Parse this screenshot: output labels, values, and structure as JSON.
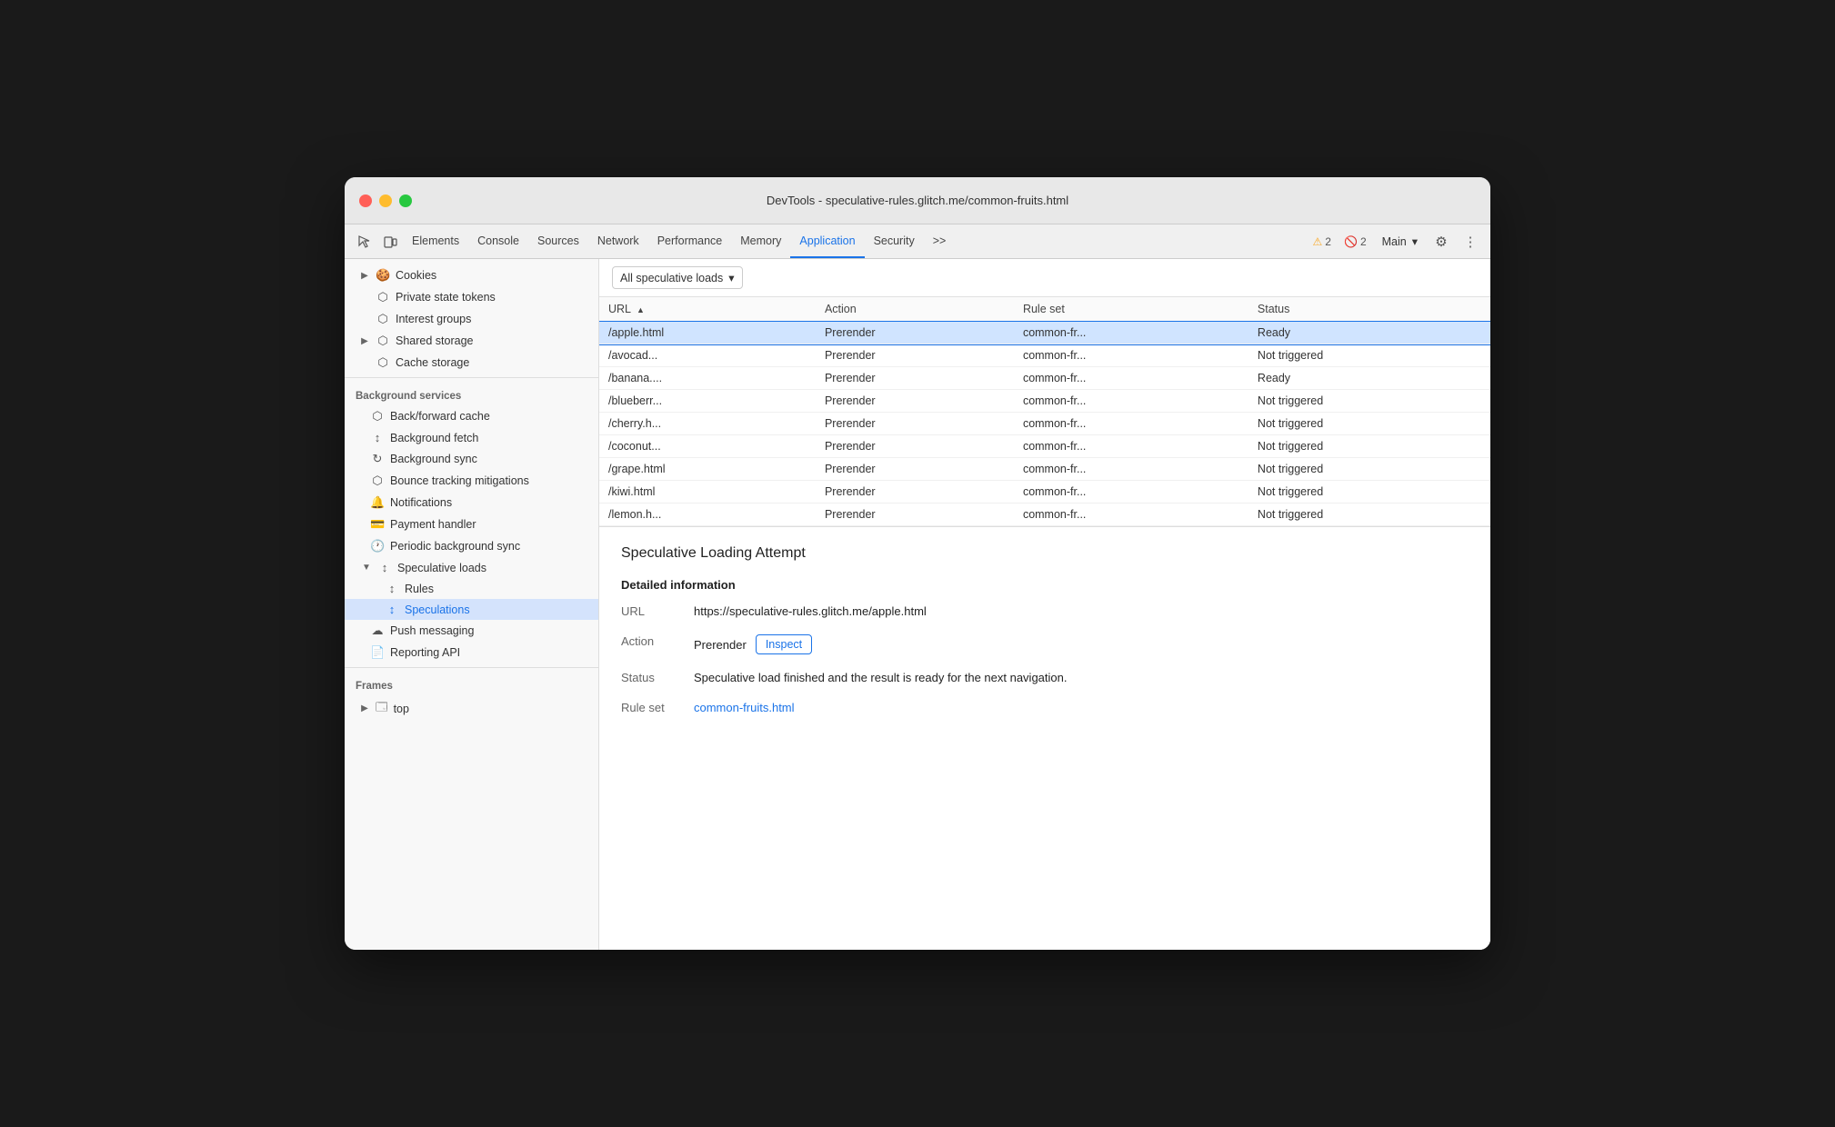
{
  "window": {
    "title": "DevTools - speculative-rules.glitch.me/common-fruits.html"
  },
  "tabs": {
    "items": [
      {
        "label": "Elements",
        "active": false
      },
      {
        "label": "Console",
        "active": false
      },
      {
        "label": "Sources",
        "active": false
      },
      {
        "label": "Network",
        "active": false
      },
      {
        "label": "Performance",
        "active": false
      },
      {
        "label": "Memory",
        "active": false
      },
      {
        "label": "Application",
        "active": true
      },
      {
        "label": "Security",
        "active": false
      }
    ],
    "overflow_label": ">>",
    "warnings_count": "2",
    "errors_count": "2",
    "main_label": "Main",
    "settings_icon": "⚙",
    "more_icon": "⋮"
  },
  "sidebar": {
    "storage_label": "",
    "cookies_label": "Cookies",
    "private_state_tokens_label": "Private state tokens",
    "interest_groups_label": "Interest groups",
    "shared_storage_label": "Shared storage",
    "cache_storage_label": "Cache storage",
    "background_services_label": "Background services",
    "back_forward_cache_label": "Back/forward cache",
    "background_fetch_label": "Background fetch",
    "background_sync_label": "Background sync",
    "bounce_tracking_label": "Bounce tracking mitigations",
    "notifications_label": "Notifications",
    "payment_handler_label": "Payment handler",
    "periodic_bg_sync_label": "Periodic background sync",
    "speculative_loads_label": "Speculative loads",
    "rules_label": "Rules",
    "speculations_label": "Speculations",
    "push_messaging_label": "Push messaging",
    "reporting_api_label": "Reporting API",
    "frames_label": "Frames",
    "top_label": "top"
  },
  "toolbar": {
    "filter_label": "All speculative loads",
    "filter_dropdown_icon": "▾"
  },
  "table": {
    "columns": [
      {
        "label": "URL",
        "sort": "▲"
      },
      {
        "label": "Action",
        "sort": ""
      },
      {
        "label": "Rule set",
        "sort": ""
      },
      {
        "label": "Status",
        "sort": ""
      }
    ],
    "rows": [
      {
        "url": "/apple.html",
        "action": "Prerender",
        "ruleset": "common-fr...",
        "status": "Ready",
        "selected": true
      },
      {
        "url": "/avocad...",
        "action": "Prerender",
        "ruleset": "common-fr...",
        "status": "Not triggered",
        "selected": false
      },
      {
        "url": "/banana....",
        "action": "Prerender",
        "ruleset": "common-fr...",
        "status": "Ready",
        "selected": false
      },
      {
        "url": "/blueberr...",
        "action": "Prerender",
        "ruleset": "common-fr...",
        "status": "Not triggered",
        "selected": false
      },
      {
        "url": "/cherry.h...",
        "action": "Prerender",
        "ruleset": "common-fr...",
        "status": "Not triggered",
        "selected": false
      },
      {
        "url": "/coconut...",
        "action": "Prerender",
        "ruleset": "common-fr...",
        "status": "Not triggered",
        "selected": false
      },
      {
        "url": "/grape.html",
        "action": "Prerender",
        "ruleset": "common-fr...",
        "status": "Not triggered",
        "selected": false
      },
      {
        "url": "/kiwi.html",
        "action": "Prerender",
        "ruleset": "common-fr...",
        "status": "Not triggered",
        "selected": false
      },
      {
        "url": "/lemon.h...",
        "action": "Prerender",
        "ruleset": "common-fr...",
        "status": "Not triggered",
        "selected": false
      }
    ]
  },
  "detail": {
    "title": "Speculative Loading Attempt",
    "section_title": "Detailed information",
    "url_label": "URL",
    "url_value": "https://speculative-rules.glitch.me/apple.html",
    "action_label": "Action",
    "action_value": "Prerender",
    "inspect_label": "Inspect",
    "status_label": "Status",
    "status_value": "Speculative load finished and the result is ready for the next navigation.",
    "ruleset_label": "Rule set",
    "ruleset_link": "common-fruits.html"
  }
}
